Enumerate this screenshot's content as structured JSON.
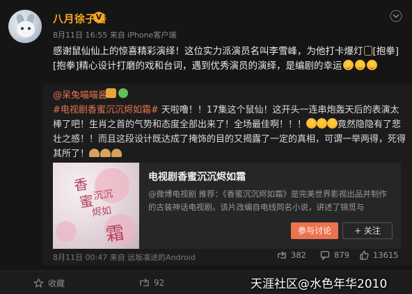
{
  "post": {
    "username": "八月徐子善",
    "verified_badge": "V",
    "meta": "8月11日 16:55 来自 iPhone客户端",
    "text_part1": "感谢鼠仙仙上的惊喜精彩演绎！这位实力派演员名叫李雪峰，为他打卡爆灯",
    "text_part2": "[抱拳][抱拳]精心设计打磨的戏和台词，遇到优秀演员的演绎，是编剧的幸运"
  },
  "repost": {
    "user": "@呆兔喵喵酱",
    "hashtag": "#电视剧香蜜沉沉烬如霜#",
    "text_a": " 天啦噜！！17集这个鼠仙！这开头一连串炮轰天后的表演太棒了吧！生肖之首的气势和态度全部出来了！全场最佳啊！！！",
    "text_b": "竟然隐隐有了悲壮之感！！而且这段设计既达成了掩饰的目的又揭露了一定的真相，可谓一举两得，死得其所了！",
    "card": {
      "title": "电视剧香蜜沉沉烬如霜",
      "description": "@微博电视剧 推荐：《香蜜沉沉烬如霜》是完美世界影视出品并制作的古装神话电视剧。该片改编自电线同名小说，讲述了锦觅与",
      "discuss_label": "参与讨论",
      "follow_label": "+ 关注",
      "image_text_1": "香",
      "image_text_2": "蜜",
      "image_text_3": "沉沉",
      "image_text_4": "烬如",
      "image_text_5": "霜"
    },
    "footer": "8月11日 00:47 来自 远坂凛送的Android",
    "shares": "382",
    "comments": "879",
    "likes": "13615"
  },
  "actions": {
    "favorite_label": "收藏",
    "share_count": "92"
  },
  "watermark": "天涯社区@水色年华2010",
  "colors": {
    "accent": "#eb7350",
    "username": "#f5a623",
    "background": "#151515"
  }
}
